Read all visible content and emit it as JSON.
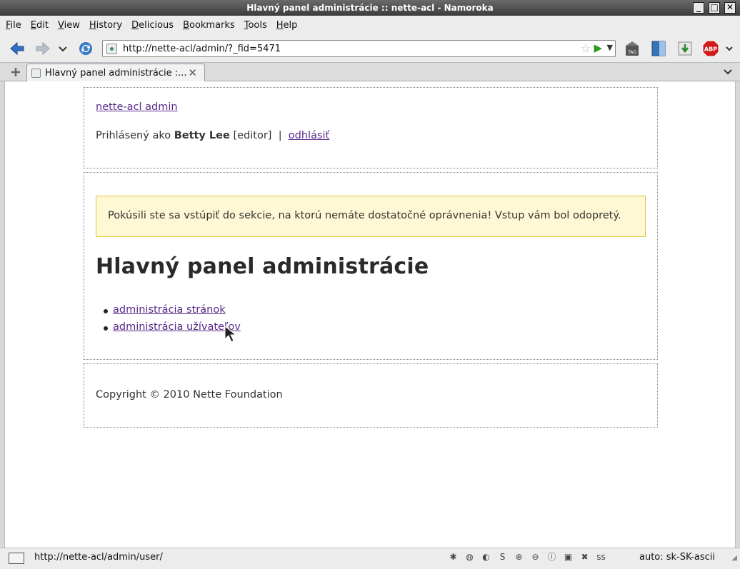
{
  "window": {
    "title": "Hlavný panel administrácie :: nette-acl - Namoroka"
  },
  "menubar": [
    "File",
    "Edit",
    "View",
    "History",
    "Delicious",
    "Bookmarks",
    "Tools",
    "Help"
  ],
  "toolbar": {
    "url": "http://nette-acl/admin/?_fid=5471"
  },
  "tabs": [
    {
      "label": "Hlavný panel administrácie :..."
    }
  ],
  "page": {
    "site_link": "nette-acl admin",
    "logged_as_prefix": "Prihlásený ako",
    "user_name": "Betty Lee",
    "user_role": "[editor]",
    "separator": "|",
    "logout_link": "odhlásiť",
    "flash_message": "Pokúsili ste sa vstúpiť do sekcie, na ktorú nemáte dostatočné oprávnenia! Vstup vám bol odopretý.",
    "heading": "Hlavný panel administrácie",
    "menu": [
      {
        "label": "administrácia stránok"
      },
      {
        "label": "administrácia užívateľov"
      }
    ],
    "copyright": "Copyright © 2010 Nette Foundation"
  },
  "statusbar": {
    "url": "http://nette-acl/admin/user/",
    "encoding": "auto: sk-SK-ascii"
  }
}
